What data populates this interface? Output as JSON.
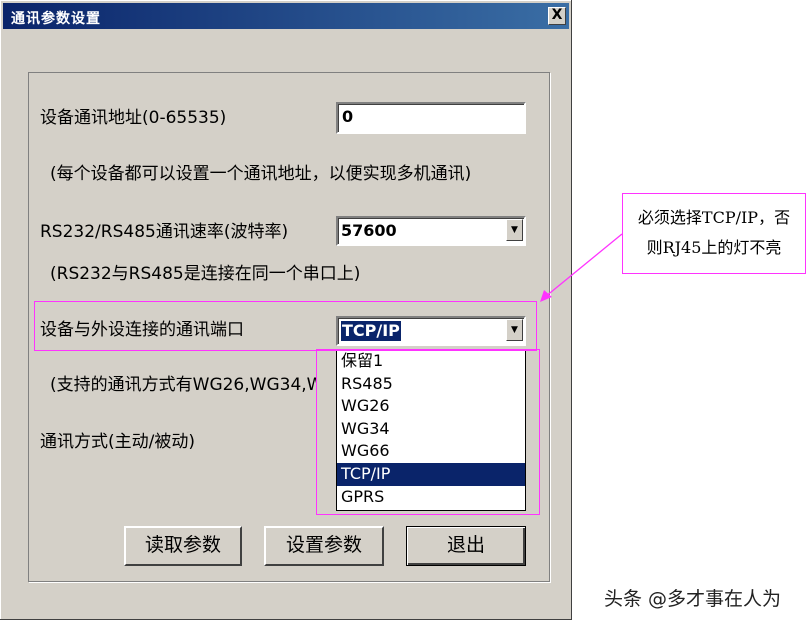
{
  "window": {
    "title": "通讯参数设置",
    "close_glyph": "X"
  },
  "fields": {
    "address": {
      "label": "设备通讯地址(0-65535)",
      "value": "0",
      "hint": "(每个设备都可以设置一个通讯地址，以便实现多机通讯)"
    },
    "baud": {
      "label": "RS232/RS485通讯速率(波特率)",
      "value": "57600",
      "hint": "(RS232与RS485是连接在同一个串口上)"
    },
    "port": {
      "label": "设备与外设连接的通讯端口",
      "value": "TCP/IP",
      "hint": "(支持的通讯方式有WG26,WG34,WG",
      "options": [
        "保留1",
        "RS485",
        "WG26",
        "WG34",
        "WG66",
        "TCP/IP",
        "GPRS"
      ],
      "selected_index": 5
    },
    "mode": {
      "label": "通讯方式(主动/被动)"
    }
  },
  "buttons": {
    "read": "读取参数",
    "set": "设置参数",
    "exit": "退出"
  },
  "annotation": {
    "line1": "必须选择TCP/IP，否",
    "line2": "则RJ45上的灯不亮"
  },
  "watermark": "头条 @多才事在人为",
  "colors": {
    "highlight": "#0a246a",
    "annotation": "#ff33ff",
    "dialog_bg": "#d4d0c8"
  }
}
